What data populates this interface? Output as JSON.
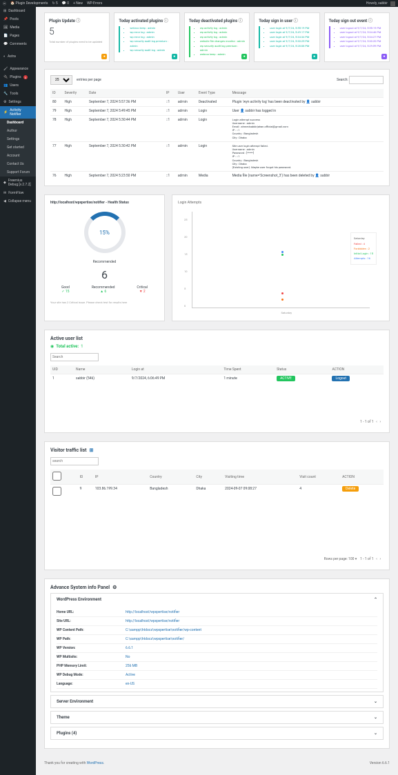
{
  "topbar": {
    "site": "Plugin Developments",
    "updates": "5",
    "comments": "0",
    "new": "New",
    "wperrors": "WP-Errors",
    "howdy": "Howdy, sabbir"
  },
  "sidebar": {
    "items": [
      {
        "label": "Dashboard",
        "icon": "dashboard-icon"
      },
      {
        "label": "Posts",
        "icon": "posts-icon"
      },
      {
        "label": "Media",
        "icon": "media-icon"
      },
      {
        "label": "Pages",
        "icon": "pages-icon"
      },
      {
        "label": "Comments",
        "icon": "comments-icon"
      }
    ],
    "group2": [
      {
        "label": "Astra",
        "icon": "astra-icon"
      }
    ],
    "group3": [
      {
        "label": "Appearance",
        "icon": "appearance-icon"
      },
      {
        "label": "Plugins",
        "icon": "plugins-icon",
        "badge": "3"
      },
      {
        "label": "Users",
        "icon": "users-icon"
      },
      {
        "label": "Tools",
        "icon": "tools-icon"
      },
      {
        "label": "Settings",
        "icon": "settings-icon"
      }
    ],
    "activity": {
      "label": "Activity Notifier"
    },
    "activity_sub": [
      {
        "label": "Dashboard",
        "current": true
      },
      {
        "label": "Author"
      },
      {
        "label": "Settings"
      },
      {
        "label": "Get started"
      },
      {
        "label": "Account"
      },
      {
        "label": "Contact Us"
      },
      {
        "label": "Support Forum"
      }
    ],
    "group4": [
      {
        "label": "Freemius Debug [v.2.7.2]"
      },
      {
        "label": "FormFlow"
      }
    ],
    "collapse": "Collapse menu"
  },
  "cards": [
    {
      "title": "Plugin Update",
      "big": "5",
      "footer": "Total number of plugins need to be updated",
      "color": "orange"
    },
    {
      "title": "Today activated plugins",
      "items": [
        "webroo keep : admin",
        "wp error log : admin",
        "wp error log : admin",
        "wp security audit log premium : admin",
        "wp security audit log : admin"
      ],
      "color": "teal"
    },
    {
      "title": "Today deactivated plugins",
      "items": [
        "wp activity log : admin",
        "wp activity log : admin",
        "wp activity log : admin",
        "website file changes monitor : admin",
        "wp security audit log premium : admin",
        "webroo keep : admin"
      ],
      "color": "green"
    },
    {
      "title": "Today sign in user",
      "items": [
        "user login at 9/7/24, 5:55:19 PM",
        "user login at 9/7/24, 5:49:17 PM",
        "user login at 9/7/24, 5:34:34 PM",
        "user login at 9/7/24, 5:30:25 PM",
        "user login at 9/7/24, 5:28:08 PM"
      ],
      "color": "teal"
    },
    {
      "title": "Today sign out event",
      "items": [
        "user logout at 9/7/24, 5:55:19 PM",
        "user logout at 9/7/24, 5:34:46 PM",
        "user logout at 9/7/24, 5:34:27 PM",
        "user logout at 9/7/24, 5:30:20 PM",
        "user logout at 9/7/24, 5:29:59 PM"
      ],
      "color": "purple"
    }
  ],
  "logtable": {
    "per_page": "25",
    "per_page_label": "entries per page",
    "search_label": "Search:",
    "headers": [
      "ID",
      "Severity",
      "Date",
      "IP",
      "User",
      "Event Type",
      "Message"
    ],
    "rows": [
      {
        "id": "80",
        "sev": "High",
        "date": "September 7, 2024 5:57:36 PM",
        "ip": "::1",
        "user": "admin",
        "type": "Deactivated",
        "msg": "Plugin 'wyn activity log' has been deactivated by 👤 sabbir"
      },
      {
        "id": "79",
        "sev": "High",
        "date": "September 7, 2024 5:49:45 PM",
        "ip": "::1",
        "user": "admin",
        "type": "Login",
        "msg": "User 👤 sabbir has logged in"
      },
      {
        "id": "78",
        "sev": "High",
        "date": "September 7, 2024 5:30:44 PM",
        "ip": "::1",
        "user": "admin",
        "type": "Login",
        "msg_block": [
          "Login attempt success",
          "Username : admin",
          "Email : ahmedsabbirjahan.official@gmail.com",
          "IP : ::1",
          "Country : Bangladesh",
          "City : Dhaka"
        ]
      },
      {
        "id": "77",
        "sev": "High",
        "date": "September 7, 2024 5:30:42 PM",
        "ip": "::1",
        "user": "admin",
        "type": "Login",
        "msg_block": [
          "Site user login attempt failed.",
          "Username : admin",
          "Password : [*****]",
          "IP : ::1",
          "Country : Bangladesh",
          "City : Dhaka",
          "(Existing user). Maybe user forgot his password."
        ]
      },
      {
        "id": "76",
        "sev": "High",
        "date": "September 7, 2024 5:23:50 PM",
        "ip": "::1",
        "user": "admin",
        "type": "Media",
        "msg": "Media file (name='Screenshot_3') has been deleted by 👤 sabbir"
      }
    ]
  },
  "health": {
    "title": "http://localhost/wpxpertise/notifier - Health Status",
    "percent": "15%",
    "recommended_label": "Recommended",
    "count": "6",
    "good": {
      "label": "Good",
      "val": "✓ 15"
    },
    "rec": {
      "label": "Recommended",
      "val": "▲ 6"
    },
    "critical": {
      "label": "Critical",
      "val": "▼ 2",
      "color": "red"
    },
    "note": "Your site has 2 Critical issue. Please check test for results here"
  },
  "chart_data": {
    "type": "line",
    "title": "Login Attempts",
    "xlabel": "Saturday",
    "ylim": [
      0,
      30
    ],
    "yticks": [
      0,
      5,
      10,
      15,
      20,
      25
    ],
    "categories": [
      "Saturday"
    ],
    "series": [
      {
        "name": "Failed",
        "values": [
          4
        ],
        "color": "#ef4444"
      },
      {
        "name": "Forbidden",
        "values": [
          2
        ],
        "color": "#f97316"
      },
      {
        "name": "Initial Login",
        "values": [
          15
        ],
        "color": "#22c55e"
      },
      {
        "name": "Attempts",
        "values": [
          16
        ],
        "color": "#3b82f6"
      }
    ],
    "legend_header": "Saturday"
  },
  "active_users": {
    "title": "Active user list",
    "total_label": "Total active:",
    "total": "1",
    "search_placeholder": "Search",
    "headers": [
      "UID",
      "Name",
      "Login at",
      "Time Spent",
      "Status",
      "ACTION"
    ],
    "rows": [
      {
        "uid": "1",
        "name": "sabbir (546)",
        "login": "9/7/2024, 6:06:49 PM",
        "time": "1 minute",
        "status": "ACTIVE",
        "action": "Logout"
      }
    ],
    "pagination": "1 - 1 of 1"
  },
  "visitor": {
    "title": "Visitor traffic list",
    "search_placeholder": "search",
    "headers": [
      "",
      "ID",
      "IP",
      "Country",
      "City",
      "Visiting time",
      "Visit count",
      "ACTION"
    ],
    "rows": [
      {
        "id": "9",
        "ip": "103.86.199.34",
        "country": "Bangladesh",
        "city": "Dhaka",
        "time": "2024-09-07 09:08:27",
        "count": "4",
        "action": "Delete"
      }
    ],
    "rows_per_page_label": "Rows per page:",
    "rows_per_page": "100",
    "pagination": "1 - 1 of 1"
  },
  "sysinfo": {
    "title": "Advance System info Panel",
    "sections": {
      "wp_env": {
        "title": "WordPress Environment",
        "rows": [
          {
            "k": "Home URL:",
            "v": "http://localhost/wpxpertise/notifier"
          },
          {
            "k": "Site URL:",
            "v": "http://localhost/wpxpertise/notifier"
          },
          {
            "k": "WP Content Path:",
            "v": "C:\\xampp\\htdocs\\wpxpertise\\notifier/wp-content"
          },
          {
            "k": "WP Path:",
            "v": "C:\\xampp\\htdocs\\wpxpertise\\notifier/"
          },
          {
            "k": "WP Version:",
            "v": "6.6.1"
          },
          {
            "k": "WP Multisite:",
            "v": "No"
          },
          {
            "k": "PHP Memory Limit:",
            "v": "256 MB"
          },
          {
            "k": "WP Debug Mode:",
            "v": "Active"
          },
          {
            "k": "Language:",
            "v": "en-US"
          }
        ]
      },
      "server": {
        "title": "Server Environment"
      },
      "theme": {
        "title": "Theme"
      },
      "plugins": {
        "title": "Plugins (4)"
      }
    }
  },
  "footer": {
    "thanks": "Thank you for creating with",
    "wp": "WordPress",
    "version": "Version 6.6.1"
  }
}
